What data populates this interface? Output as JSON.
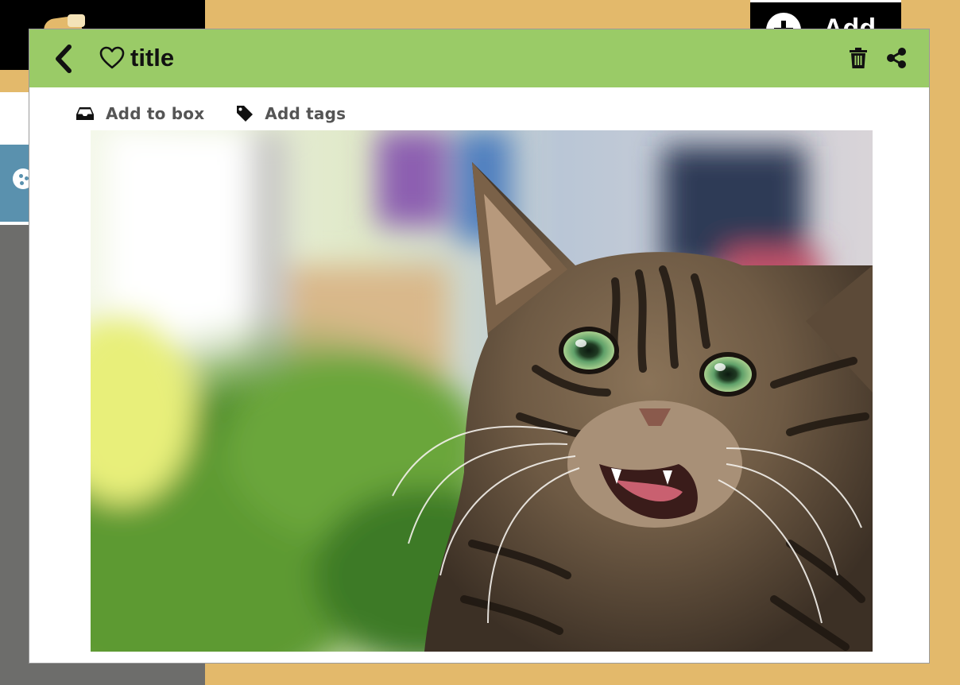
{
  "background_app": {
    "add_button_label": "Add"
  },
  "modal": {
    "title": "title",
    "actions": {
      "add_to_box": "Add to box",
      "add_tags": "Add tags"
    },
    "image": {
      "alt": "tabby kitten meowing"
    }
  },
  "colors": {
    "header": "#9acb67",
    "page_background": "#e3b96b",
    "sidebar_blue": "#5a91ae",
    "sidebar_grey": "#6d6d6b"
  },
  "icons": [
    "back-icon",
    "heart-icon",
    "trash-icon",
    "share-icon",
    "inbox-icon",
    "tag-icon",
    "add-circle-icon"
  ]
}
